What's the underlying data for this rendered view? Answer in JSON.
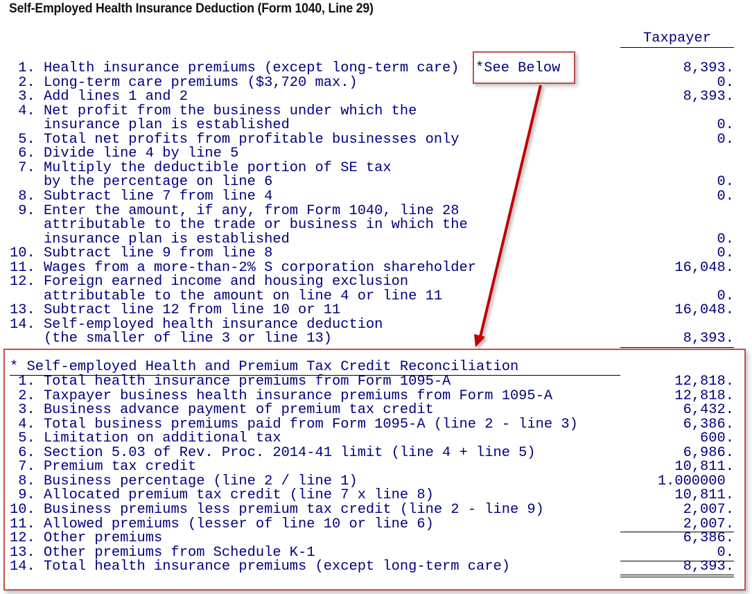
{
  "page": {
    "title": "Self-Employed Health Insurance Deduction (Form 1040, Line 29)",
    "column_header": "Taxpayer"
  },
  "worksheet": {
    "lines": [
      {
        "label": " 1. Health insurance premiums (except long-term care)",
        "value": "8,393."
      },
      {
        "label": " 2. Long-term care premiums ($3,720 max.)",
        "value": "0."
      },
      {
        "label": " 3. Add lines 1 and 2",
        "value": "8,393."
      },
      {
        "label": " 4. Net profit from the business under which the",
        "value": ""
      },
      {
        "label": "    insurance plan is established",
        "value": "0."
      },
      {
        "label": " 5. Total net profits from profitable businesses only",
        "value": "0."
      },
      {
        "label": " 6. Divide line 4 by line 5",
        "value": ""
      },
      {
        "label": " 7. Multiply the deductible portion of SE tax",
        "value": ""
      },
      {
        "label": "    by the percentage on line 6",
        "value": "0."
      },
      {
        "label": " 8. Subtract line 7 from line 4",
        "value": "0."
      },
      {
        "label": " 9. Enter the amount, if any, from Form 1040, line 28",
        "value": ""
      },
      {
        "label": "    attributable to the trade or business in which the",
        "value": ""
      },
      {
        "label": "    insurance plan is established",
        "value": "0."
      },
      {
        "label": "10. Subtract line 9 from line 8",
        "value": "0."
      },
      {
        "label": "11. Wages from a more-than-2% S corporation shareholder",
        "value": "16,048."
      },
      {
        "label": "12. Foreign earned income and housing exclusion",
        "value": ""
      },
      {
        "label": "    attributable to the amount on line 4 or line 11",
        "value": "0."
      },
      {
        "label": "13. Subtract line 12 from line 10 or 11",
        "value": "16,048."
      },
      {
        "label": "14. Self-employed health insurance deduction",
        "value": ""
      },
      {
        "label": "    (the smaller of line 3 or line 13)",
        "value": "8,393."
      }
    ],
    "see_below_note": "*See Below"
  },
  "reconciliation": {
    "title": "* Self-employed Health and Premium Tax Credit Reconciliation",
    "lines": [
      {
        "label": " 1. Total health insurance premiums from Form 1095-A",
        "value": "12,818."
      },
      {
        "label": " 2. Taxpayer business health insurance premiums from Form 1095-A",
        "value": "12,818."
      },
      {
        "label": " 3. Business advance payment of premium tax credit",
        "value": "6,432."
      },
      {
        "label": " 4. Total business premiums paid from Form 1095-A (line 2 - line 3)",
        "value": "6,386."
      },
      {
        "label": " 5. Limitation on additional tax",
        "value": "600."
      },
      {
        "label": " 6. Section 5.03 of Rev. Proc. 2014-41 limit (line 4 + line 5)",
        "value": "6,986."
      },
      {
        "label": " 7. Premium tax credit",
        "value": "10,811."
      },
      {
        "label": " 8. Business percentage (line 2 / line 1)",
        "value": "1.000000 "
      },
      {
        "label": " 9. Allocated premium tax credit (line 7 x line 8)",
        "value": "10,811."
      },
      {
        "label": "10. Business premiums less premium tax credit (line 2 - line 9)",
        "value": "2,007."
      },
      {
        "label": "11. Allowed premiums (lesser of line 10 or line 6)",
        "value": "2,007."
      },
      {
        "label": "12. Other premiums",
        "value": "6,386."
      },
      {
        "label": "13. Other premiums from Schedule K-1",
        "value": "0."
      },
      {
        "label": "14. Total health insurance premiums (except long-term care)",
        "value": "8,393."
      }
    ]
  },
  "colors": {
    "text": "#00007f",
    "callout_border": "#c0504d",
    "arrow": "#c00000"
  }
}
